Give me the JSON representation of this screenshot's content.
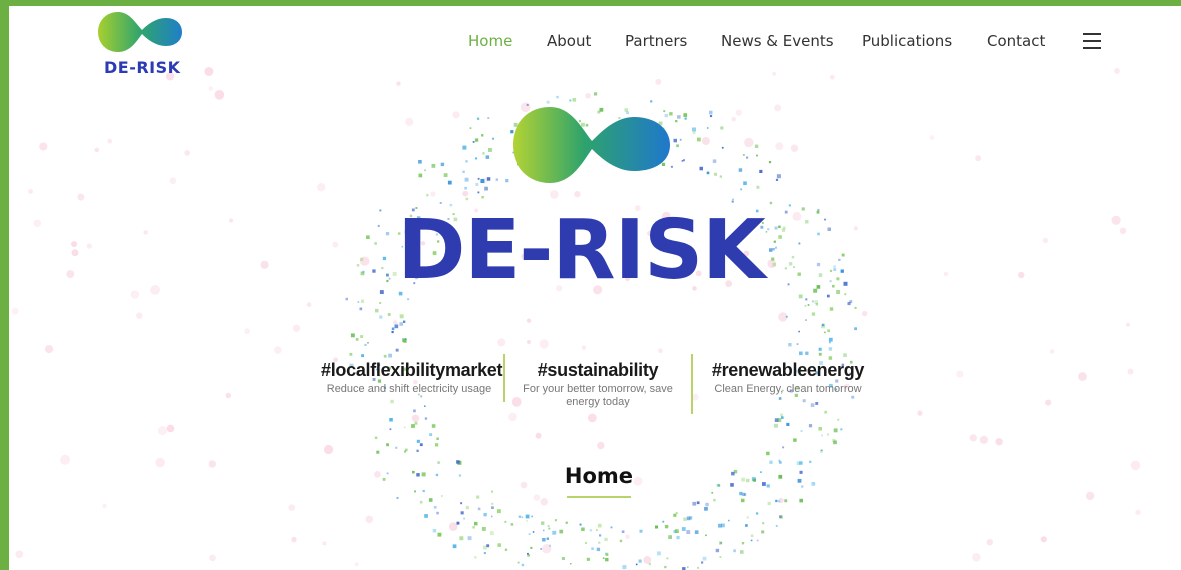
{
  "brand": {
    "name": "DE-RISK"
  },
  "nav": {
    "items": [
      {
        "label": "Home",
        "active": true
      },
      {
        "label": "About"
      },
      {
        "label": "Partners"
      },
      {
        "label": "News & Events"
      },
      {
        "label": "Publications"
      },
      {
        "label": "Contact"
      }
    ],
    "menu_icon": "hamburger-menu-icon"
  },
  "hero": {
    "title": "DE-RISK",
    "tags": [
      {
        "title": "#localflexibilitymarket",
        "subtitle": "Reduce and shift electricity usage"
      },
      {
        "title": "#sustainability",
        "subtitle": "For your better tomorrow, save energy today"
      },
      {
        "title": "#renewableenergy",
        "subtitle": "Clean Energy, clean tomorrow"
      }
    ]
  },
  "page": {
    "heading": "Home"
  },
  "colors": {
    "accent_green": "#6cb043",
    "brand_blue": "#2e3cb0",
    "divider": "#b9d36b"
  }
}
